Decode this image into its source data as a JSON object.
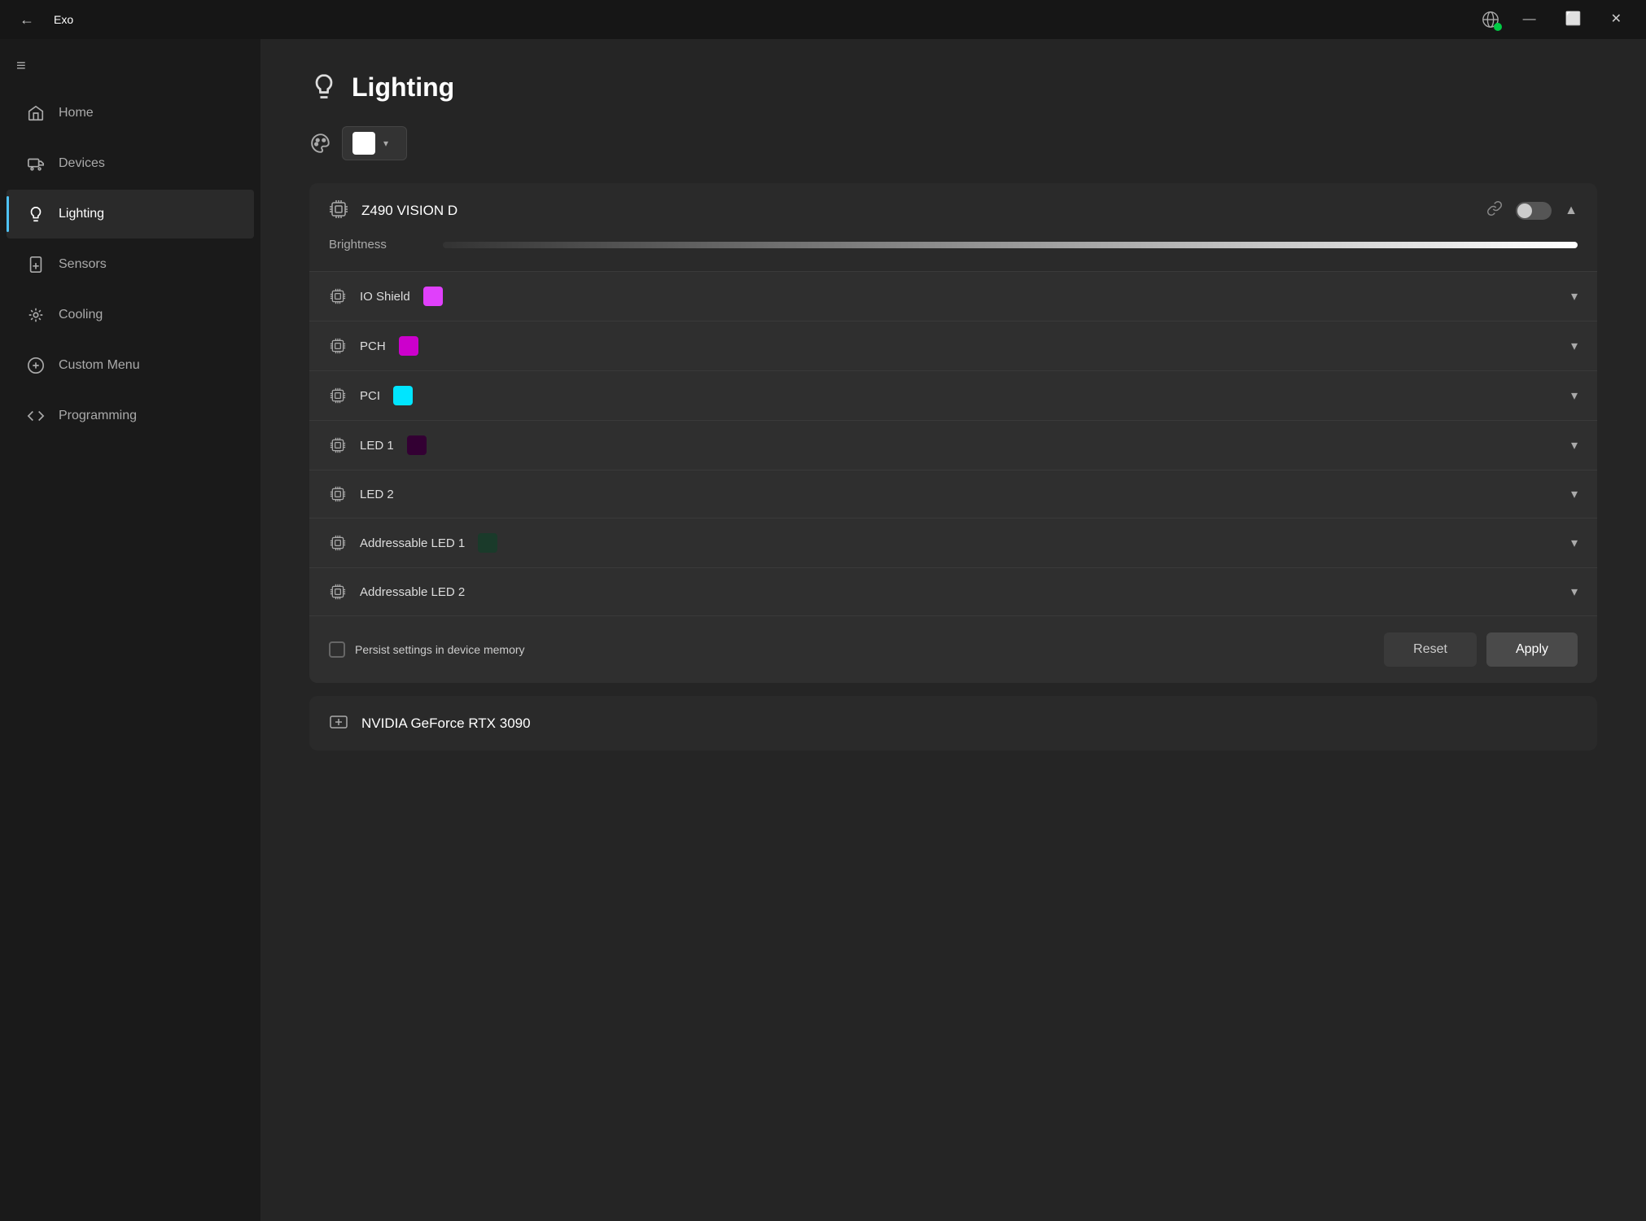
{
  "window": {
    "title": "Exo",
    "back_label": "←",
    "minimize_label": "—",
    "maximize_label": "⬜",
    "close_label": "✕"
  },
  "sidebar": {
    "menu_icon": "≡",
    "items": [
      {
        "id": "home",
        "label": "Home",
        "icon": "home"
      },
      {
        "id": "devices",
        "label": "Devices",
        "icon": "devices"
      },
      {
        "id": "lighting",
        "label": "Lighting",
        "icon": "lighting",
        "active": true
      },
      {
        "id": "sensors",
        "label": "Sensors",
        "icon": "sensors"
      },
      {
        "id": "cooling",
        "label": "Cooling",
        "icon": "cooling"
      },
      {
        "id": "custom-menu",
        "label": "Custom Menu",
        "icon": "custom-menu"
      },
      {
        "id": "programming",
        "label": "Programming",
        "icon": "programming"
      }
    ]
  },
  "main": {
    "page_title": "Lighting",
    "color_dropdown_placeholder": "white",
    "device_z490": {
      "name": "Z490 VISION D",
      "brightness_label": "Brightness",
      "zones": [
        {
          "name": "IO Shield",
          "color": "#e040fb"
        },
        {
          "name": "PCH",
          "color": "#cc00cc"
        },
        {
          "name": "PCI",
          "color": "#00e5ff"
        },
        {
          "name": "LED 1",
          "color": "#330033"
        },
        {
          "name": "LED 2",
          "color": null
        },
        {
          "name": "Addressable LED 1",
          "color": "#1a3a2a"
        },
        {
          "name": "Addressable LED 2",
          "color": null
        }
      ],
      "persist_label": "Persist settings in device memory",
      "reset_label": "Reset",
      "apply_label": "Apply"
    },
    "device_nvidia": {
      "name": "NVIDIA GeForce RTX 3090"
    }
  }
}
